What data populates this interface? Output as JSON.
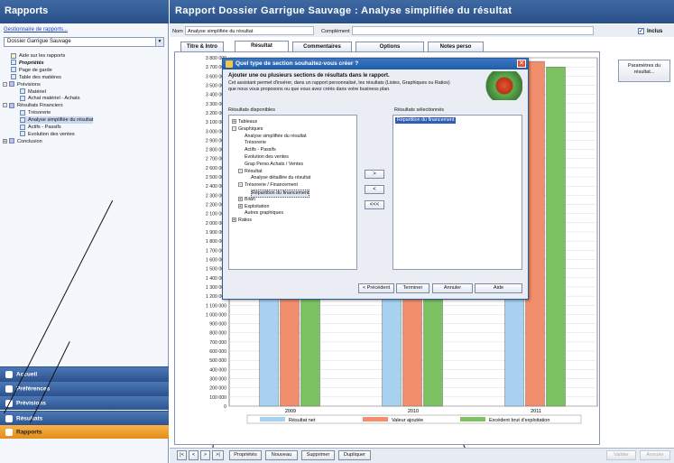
{
  "left": {
    "title": "Rapports",
    "manager_link": "Gestionnaire de rapports...",
    "dossier": "Dossier Garrigue Sauvage",
    "tree": [
      {
        "label": "Aide sur les rapports",
        "level": 1,
        "icon": "help-icon"
      },
      {
        "label": "Propriétés",
        "level": 1,
        "icon": "properties-icon",
        "bold": true
      },
      {
        "label": "Page de garde",
        "level": 1,
        "icon": "page-icon"
      },
      {
        "label": "Table des matières",
        "level": 1,
        "icon": "page-icon"
      },
      {
        "label": "Prévisions",
        "level": 0,
        "icon": "folder-icon",
        "toggle": "-"
      },
      {
        "label": "Matériel",
        "level": 2,
        "icon": "table-icon"
      },
      {
        "label": "Achat matériel - Achats",
        "level": 2,
        "icon": "table-icon"
      },
      {
        "label": "Résultats Financiers",
        "level": 0,
        "icon": "folder-icon",
        "toggle": "-"
      },
      {
        "label": "Trésorerie",
        "level": 2,
        "icon": "chart-icon"
      },
      {
        "label": "Analyse simplifiée du résultat",
        "level": 2,
        "icon": "chart-icon",
        "selected": true
      },
      {
        "label": "Actifs - Passifs",
        "level": 2,
        "icon": "chart-icon"
      },
      {
        "label": "Evolution des ventes",
        "level": 2,
        "icon": "chart-icon"
      },
      {
        "label": "Conclusion",
        "level": 0,
        "icon": "folder-icon",
        "toggle": "+"
      }
    ],
    "nav": [
      {
        "label": "Accueil",
        "icon": "home-icon"
      },
      {
        "label": "Préférences",
        "icon": "folder-icon"
      },
      {
        "label": "Prévisions",
        "icon": "table-icon"
      },
      {
        "label": "Résultats",
        "icon": "chart-icon"
      },
      {
        "label": "Rapports",
        "icon": "report-icon",
        "active": true
      }
    ]
  },
  "header": {
    "title": "Rapport Dossier Garrigue Sauvage : Analyse simplifiée du résultat",
    "nom_label": "Nom",
    "nom_value": "Analyse simplifiée du résultat",
    "complement_label": "Complément",
    "complement_value": "",
    "inclus_label": "Inclus"
  },
  "tabs": [
    "Titre & Intro",
    "Résultat",
    "Commentaires",
    "Options",
    "Notes perso"
  ],
  "active_tab": 1,
  "side_button": "Paramètres du résultat...",
  "chart_data": {
    "type": "bar",
    "categories": [
      "2009",
      "2010",
      "2011"
    ],
    "series": [
      {
        "name": "Résultat net",
        "color": "#a8d1f0",
        "values": [
          1450000,
          1450000,
          1850000
        ]
      },
      {
        "name": "Valeur ajoutée",
        "color": "#f28e6c",
        "values": [
          1450000,
          1450000,
          3760000
        ]
      },
      {
        "name": "Excédent brut d'exploitation",
        "color": "#7cc263",
        "values": [
          1450000,
          1450000,
          3700000
        ]
      }
    ],
    "ylim": [
      0,
      3800000
    ],
    "y_ticks": [
      "3 800 000",
      "3 700 000",
      "3 600 000",
      "3 500 000",
      "3 400 000",
      "3 300 000",
      "3 200 000",
      "3 100 000",
      "3 000 000",
      "2 900 000",
      "2 800 000",
      "2 700 000",
      "2 600 000",
      "2 500 000",
      "2 400 000",
      "2 300 000",
      "2 200 000",
      "2 100 000",
      "2 000 000",
      "1 900 000",
      "1 800 000",
      "1 700 000",
      "1 600 000",
      "1 500 000",
      "1 400 000",
      "1 300 000",
      "1 200 000",
      "1 100 000",
      "1 000 000",
      "900 000",
      "800 000",
      "700 000",
      "600 000",
      "500 000",
      "400 000",
      "300 000",
      "200 000",
      "100 000",
      "0"
    ],
    "legend": "bottom"
  },
  "bottom": {
    "nav_first": "|<",
    "nav_prev": "<",
    "nav_next": ">",
    "nav_last": ">|",
    "buttons": [
      "Propriétés",
      "Nouveau",
      "Supprimer",
      "Dupliquer"
    ],
    "valider": "Valider",
    "annuler": "Annuler"
  },
  "dialog": {
    "title": "Quel type de section souhaitez-vous créer ?",
    "heading": "Ajouter une ou plusieurs sections de résultats dans le rapport.",
    "description": "Cet assistant permet d'insérer, dans un rapport personnalisé, les résultats (Listes, Graphiques ou Ratios) que nous vous proposons ou que vous avez créés dans votre business plan.",
    "available_label": "Résultats disponibles",
    "selected_label": "Résultats sélectionnés",
    "available": [
      {
        "label": "Tableaux",
        "indent": 0,
        "toggle": "+"
      },
      {
        "label": "Graphiques",
        "indent": 0,
        "toggle": "-"
      },
      {
        "label": "Analyse simplifiée du résultat",
        "indent": 2
      },
      {
        "label": "Trésorerie",
        "indent": 2
      },
      {
        "label": "Actifs - Passifs",
        "indent": 2
      },
      {
        "label": "Evolution des ventes",
        "indent": 2
      },
      {
        "label": "Grap Perso Achats / Ventes",
        "indent": 2
      },
      {
        "label": "Résultat",
        "indent": 1,
        "toggle": "-"
      },
      {
        "label": "Analyse détaillée du résultat",
        "indent": 3
      },
      {
        "label": "Trésorerie / Financement",
        "indent": 1,
        "toggle": "-"
      },
      {
        "label": "Répartition du financement",
        "indent": 3,
        "selected": true
      },
      {
        "label": "Bilan",
        "indent": 1,
        "toggle": "+"
      },
      {
        "label": "Exploitation",
        "indent": 1,
        "toggle": "+"
      },
      {
        "label": "Autres graphiques",
        "indent": 2
      },
      {
        "label": "Ratios",
        "indent": 0,
        "toggle": "+"
      }
    ],
    "selected": [
      "Répartition du financement"
    ],
    "move_add": ">",
    "move_remove": "<",
    "move_remove_all": "<<<",
    "btn_prev": "< Précédent",
    "btn_finish": "Terminer",
    "btn_cancel": "Annuler",
    "btn_help": "Aide"
  }
}
